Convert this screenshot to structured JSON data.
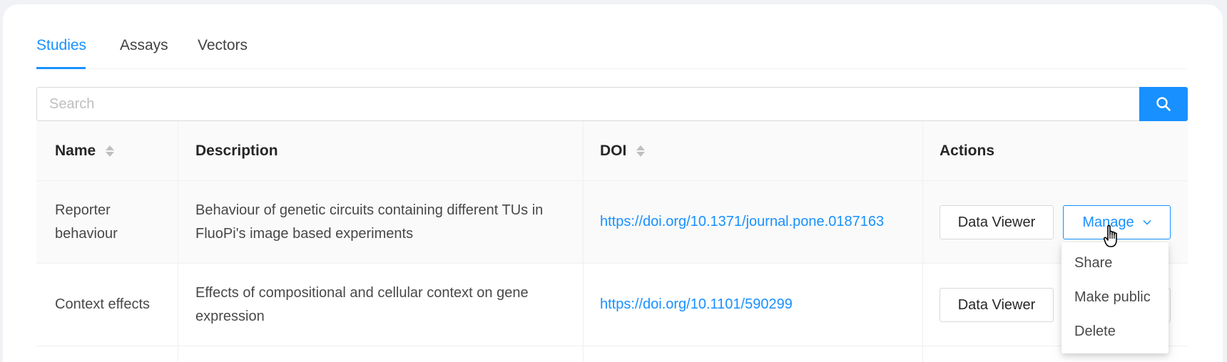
{
  "tabs": [
    {
      "label": "Studies",
      "active": true
    },
    {
      "label": "Assays",
      "active": false
    },
    {
      "label": "Vectors",
      "active": false
    }
  ],
  "search": {
    "placeholder": "Search",
    "value": ""
  },
  "table": {
    "columns": [
      "Name",
      "Description",
      "DOI",
      "Actions"
    ],
    "rows": [
      {
        "name": "Reporter behaviour",
        "description": "Behaviour of genetic circuits containing different TUs in FluoPi's image based experiments",
        "doi": "https://doi.org/10.1371/journal.pone.0187163"
      },
      {
        "name": "Context effects",
        "description": "Effects of compositional and cellular context on gene expression",
        "doi": "https://doi.org/10.1101/590299"
      }
    ],
    "actions": {
      "data_viewer_label": "Data Viewer",
      "manage_label": "Manage"
    }
  },
  "manage_menu": {
    "items": [
      "Share",
      "Make public",
      "Delete"
    ]
  },
  "colors": {
    "accent": "#1890ff",
    "header_bg": "#fafafa",
    "border": "#f0f0f0"
  },
  "icons": {
    "search_button": "search-icon",
    "sort": "sort-icon",
    "dropdown": "chevron-down-icon",
    "cursor": "hand-pointer-icon"
  }
}
